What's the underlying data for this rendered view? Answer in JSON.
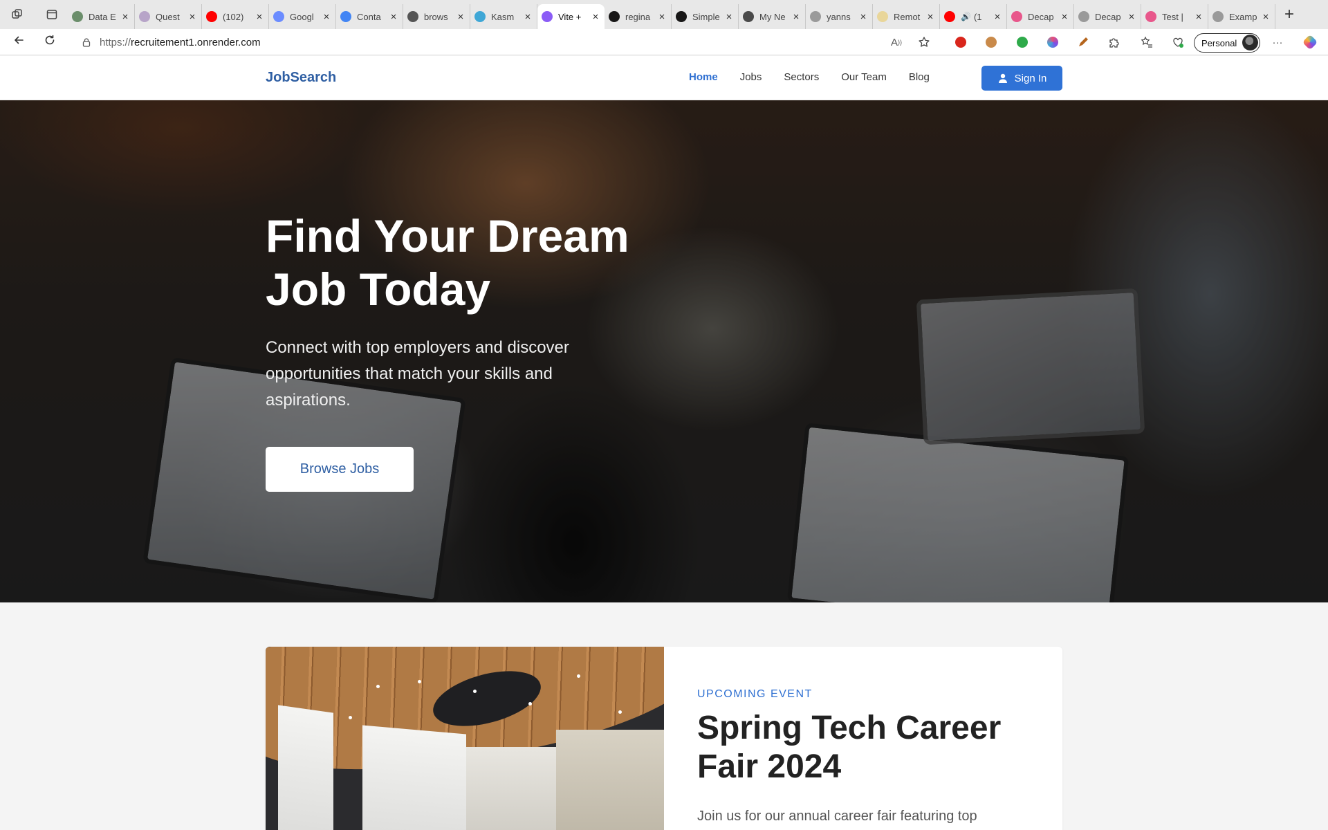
{
  "browser": {
    "tabs": [
      {
        "label": "Data E",
        "icon": "green-circle-icon",
        "color": "#6b8e6b"
      },
      {
        "label": "Quest",
        "icon": "brain-icon",
        "color": "#b7a4c8"
      },
      {
        "label": "(102)",
        "icon": "youtube-icon",
        "color": "#ff0000"
      },
      {
        "label": "Googl",
        "icon": "gemini-icon",
        "color": "#6b8cff"
      },
      {
        "label": "Conta",
        "icon": "google-icon",
        "color": "#4285f4"
      },
      {
        "label": "brows",
        "icon": "browser-use-icon",
        "color": "#555555"
      },
      {
        "label": "Kasm",
        "icon": "kasm-icon",
        "color": "#3fa7d6"
      },
      {
        "label": "Vite +",
        "icon": "vite-icon",
        "color": "#8b5cf6",
        "active": true
      },
      {
        "label": "regina",
        "icon": "github-icon",
        "color": "#181717"
      },
      {
        "label": "Simple",
        "icon": "github-icon",
        "color": "#181717"
      },
      {
        "label": "My Ne",
        "icon": "dark-circle-icon",
        "color": "#4a4a4a"
      },
      {
        "label": "yanns",
        "icon": "page-icon",
        "color": "#9a9a9a"
      },
      {
        "label": "Remot",
        "icon": "yellow-page-icon",
        "color": "#e9d69a"
      },
      {
        "label": "(1",
        "icon": "youtube-icon",
        "color": "#ff0000",
        "audio": true
      },
      {
        "label": "Decap",
        "icon": "decap-icon",
        "color": "#e8578b"
      },
      {
        "label": "Decap",
        "icon": "page-icon",
        "color": "#9a9a9a"
      },
      {
        "label": "Test |",
        "icon": "decap-icon",
        "color": "#e8578b"
      },
      {
        "label": "Examp",
        "icon": "page-icon",
        "color": "#9a9a9a"
      }
    ],
    "url_scheme": "https://",
    "url_host": "recruitement1.onrender.com",
    "profile_label": "Personal"
  },
  "site": {
    "brand": "JobSearch",
    "brand_color": "#2f5fa3",
    "accent_color": "#2e6fd1",
    "nav": [
      {
        "label": "Home",
        "active": true
      },
      {
        "label": "Jobs"
      },
      {
        "label": "Sectors"
      },
      {
        "label": "Our Team"
      },
      {
        "label": "Blog"
      }
    ],
    "signin_label": "Sign In"
  },
  "hero": {
    "title": "Find Your Dream Job Today",
    "subtitle": "Connect with top employers and discover opportunities that match your skills and aspirations.",
    "cta_label": "Browse Jobs"
  },
  "event": {
    "eyebrow": "UPCOMING EVENT",
    "title": "Spring Tech Career Fair 2024",
    "description": "Join us for our annual career fair featuring top"
  }
}
